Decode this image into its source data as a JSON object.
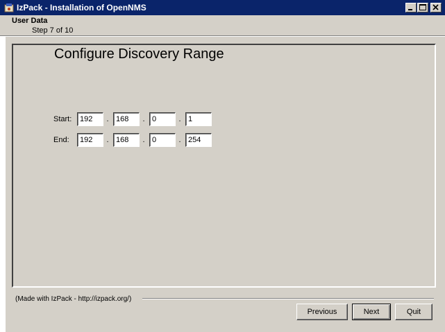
{
  "window": {
    "title": "IzPack - Installation of OpenNMS",
    "controls": [
      "minimize",
      "maximize",
      "close"
    ]
  },
  "header": {
    "title": "User Data",
    "step": "Step 7 of 10"
  },
  "panel": {
    "title": "Configure Discovery Range",
    "start": {
      "label": "Start:",
      "octets": [
        "192",
        "168",
        "0",
        "1"
      ]
    },
    "end": {
      "label": "End:",
      "octets": [
        "192",
        "168",
        "0",
        "254"
      ]
    },
    "separator": "."
  },
  "footer": {
    "made_with": "(Made with IzPack - http://izpack.org/)",
    "previous_label": "Previous",
    "next_label": "Next",
    "quit_label": "Quit"
  }
}
